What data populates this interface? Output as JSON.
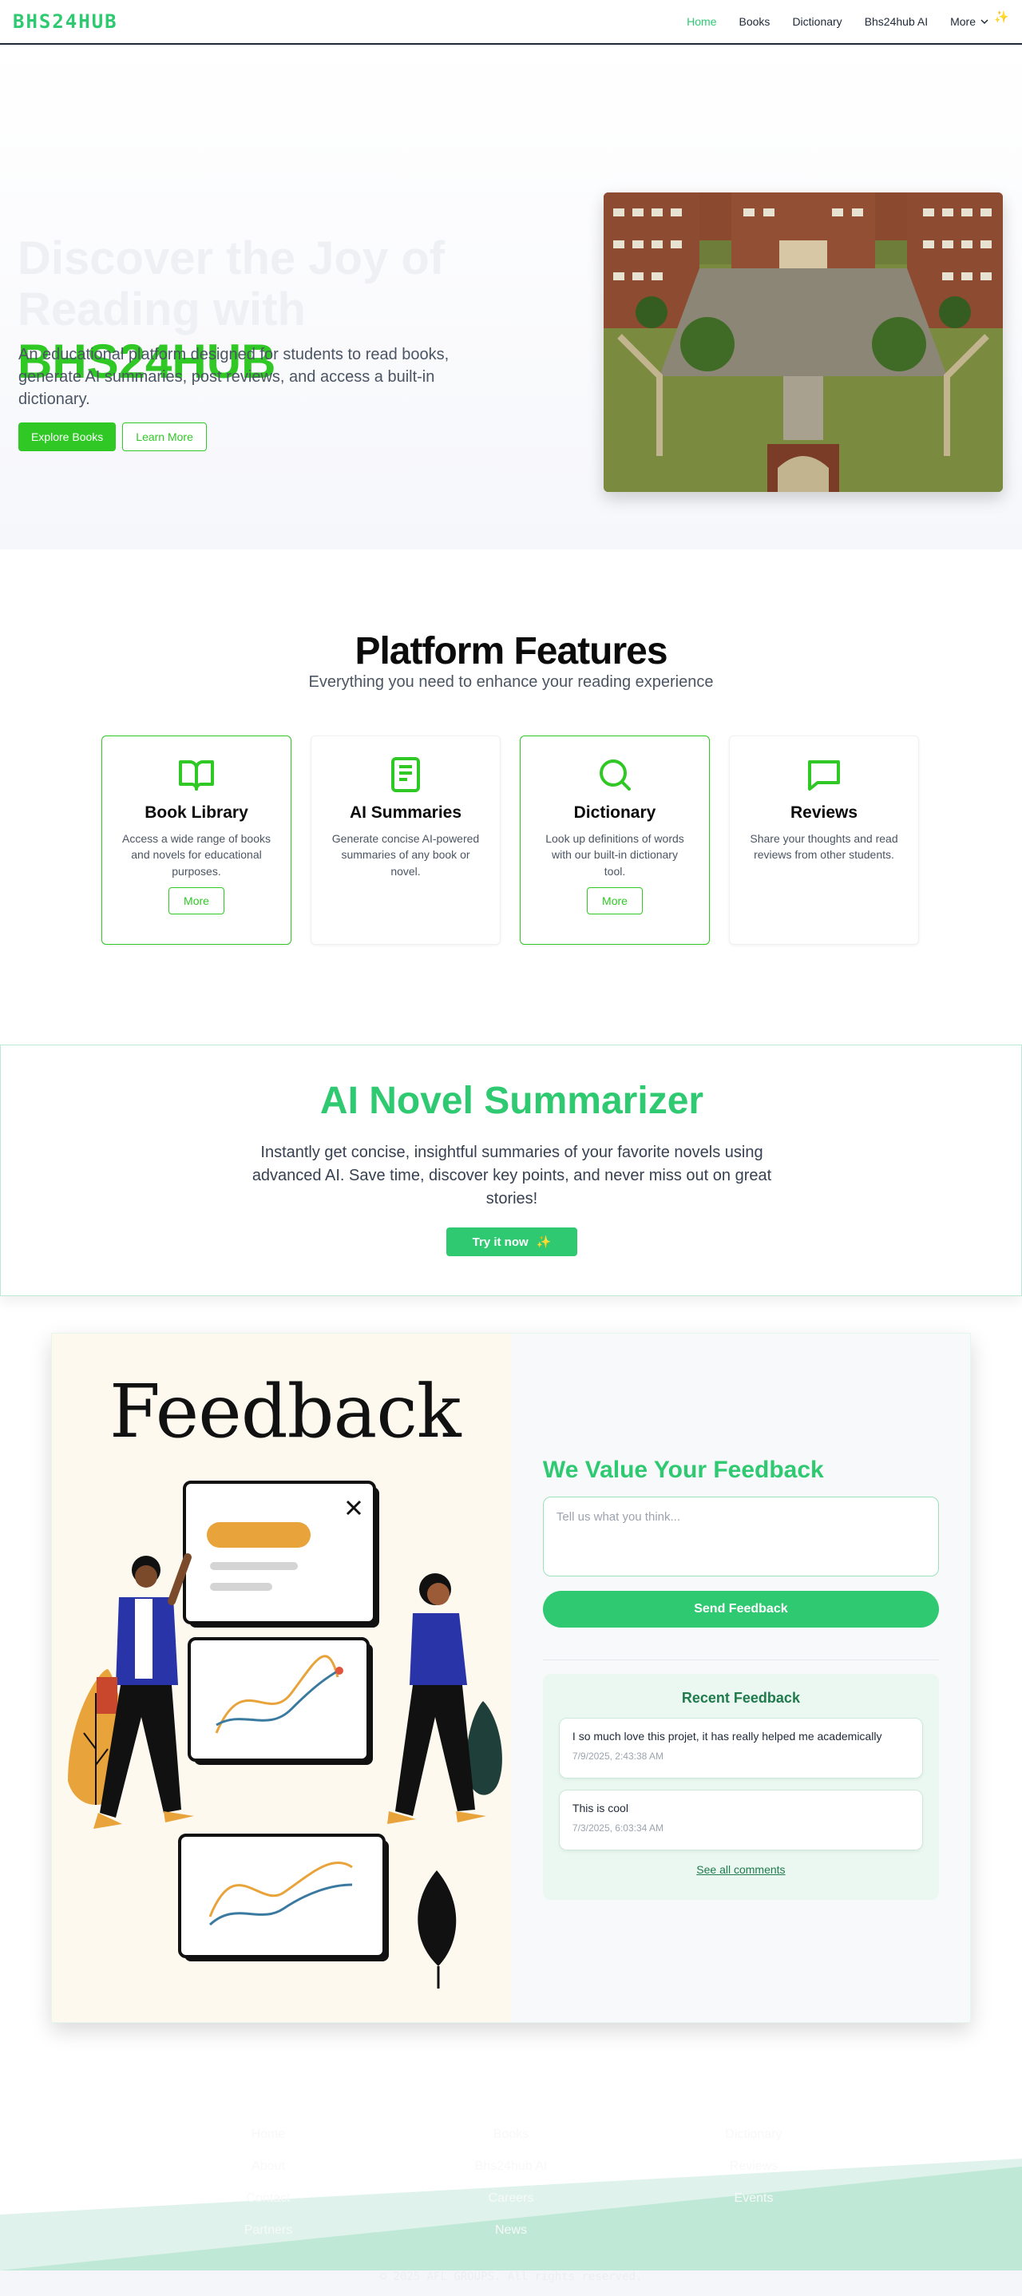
{
  "nav": {
    "brand": "BHS24HUB",
    "links": [
      "Home",
      "Books",
      "Dictionary",
      "Bhs24hub AI",
      "More"
    ],
    "sparkle": "✨"
  },
  "hero": {
    "title_line1": "Discover the Joy of",
    "title_line2": "Reading with",
    "title_brand": "BHS24HUB",
    "description": "An educational platform designed for students to read books, generate AI summaries, post reviews, and access a built-in dictionary.",
    "btn_primary": "Explore Books",
    "btn_secondary": "Learn More"
  },
  "features": {
    "title": "Platform Features",
    "subtitle": "Everything you need to enhance your reading experience",
    "cards": [
      {
        "title": "Book Library",
        "desc": "Access a wide range of books and novels for educational purposes.",
        "btn": "More",
        "icon": "book-open-icon"
      },
      {
        "title": "AI Summaries",
        "desc": "Generate concise AI-powered summaries of any book or novel.",
        "btn": "",
        "icon": "document-icon"
      },
      {
        "title": "Dictionary",
        "desc": "Look up definitions of words with our built-in dictionary tool.",
        "btn": "More",
        "icon": "search-icon"
      },
      {
        "title": "Reviews",
        "desc": "Share your thoughts and read reviews from other students.",
        "btn": "",
        "icon": "chat-icon"
      }
    ]
  },
  "summarizer": {
    "title": "AI Novel Summarizer",
    "description": "Instantly get concise, insightful summaries of your favorite novels using advanced AI. Save time, discover key points, and never miss out on great stories!",
    "button": "Try it now",
    "sparkle": "✨"
  },
  "feedback": {
    "illustration_title": "Feedback",
    "heading": "We Value Your Feedback",
    "placeholder": "Tell us what you think...",
    "send": "Send Feedback",
    "recent_title": "Recent Feedback",
    "comments": [
      {
        "text": "I so much love this projet, it has really helped me academically",
        "time": "7/9/2025, 2:43:38 AM"
      },
      {
        "text": "This is cool",
        "time": "7/3/2025, 6:03:34 AM"
      }
    ],
    "see_all": "See all comments"
  },
  "footer": {
    "col1": [
      "Home",
      "About",
      "Contact",
      "Partners"
    ],
    "col2": [
      "Books",
      "Bhs24hub AI",
      "Careers",
      "News"
    ],
    "col3": [
      "Dictionary",
      "Reviews",
      "Events"
    ],
    "copyright": "© 2025 AFL GROUPS. All rights reserved."
  },
  "colors": {
    "brand": "#2ec971",
    "hero_accent": "#2fc825",
    "footer_wave": "#bfe8d6"
  }
}
